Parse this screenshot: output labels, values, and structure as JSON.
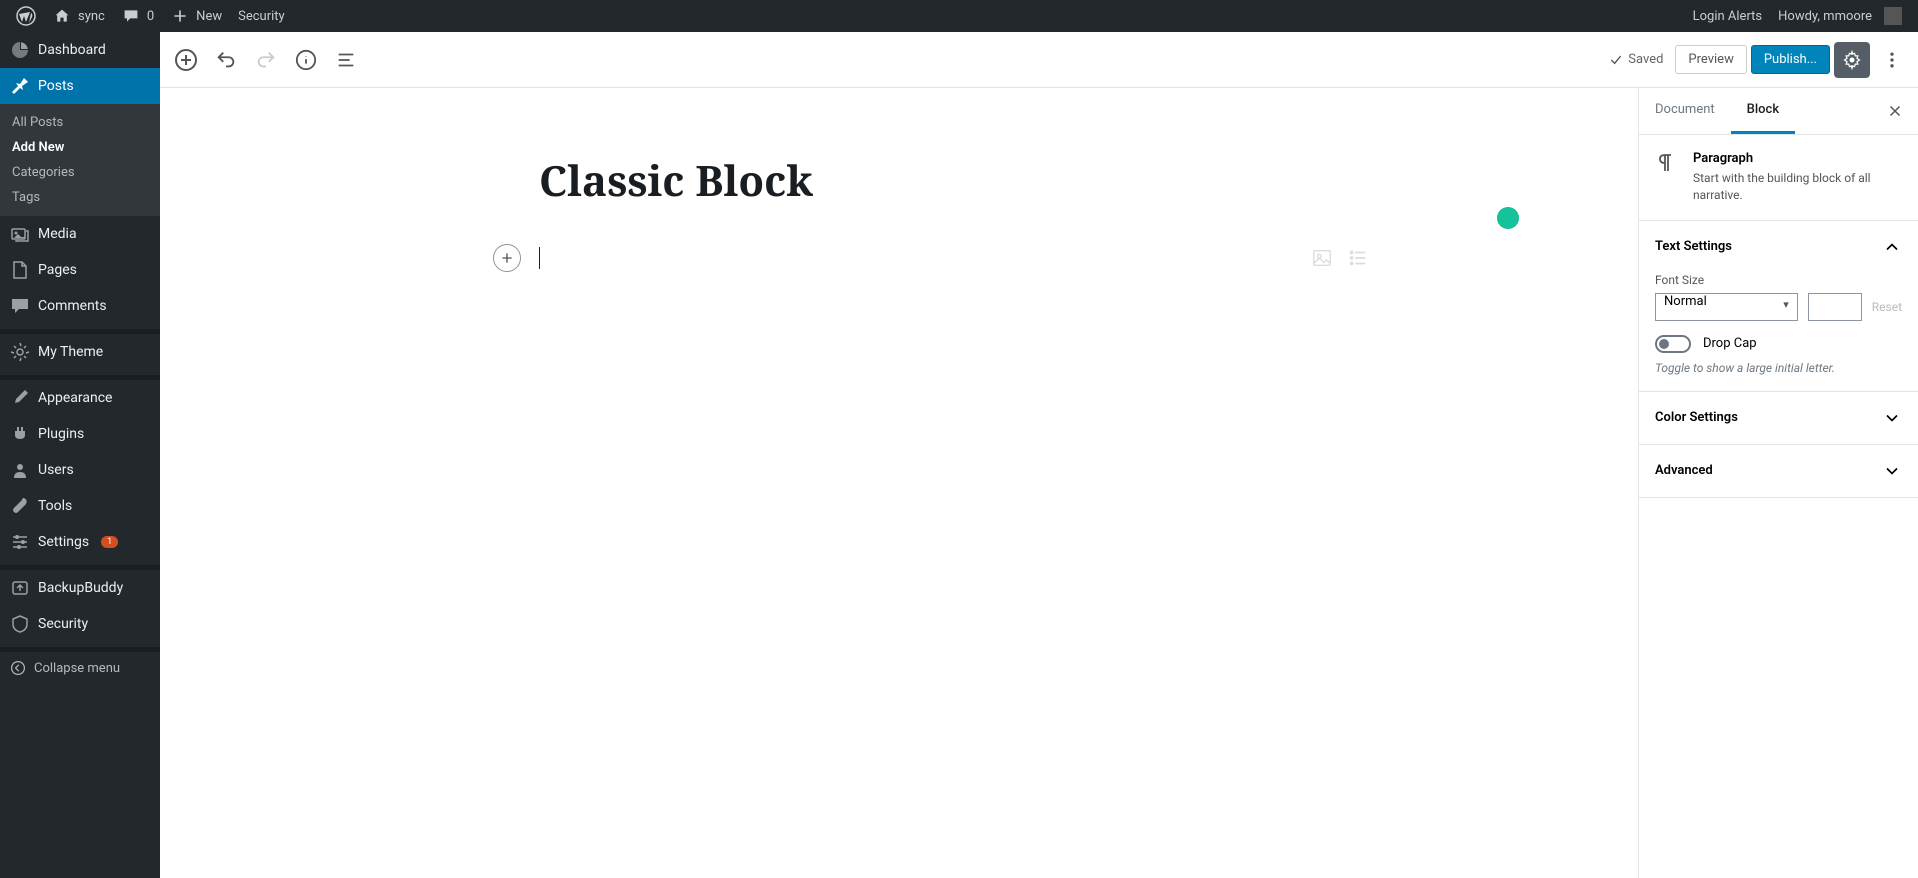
{
  "adminbar": {
    "site": "sync",
    "comment_count": "0",
    "new": "New",
    "security": "Security",
    "login_alerts": "Login Alerts",
    "howdy": "Howdy, mmoore"
  },
  "sidebar": {
    "items": [
      {
        "label": "Dashboard"
      },
      {
        "label": "Posts"
      },
      {
        "label": "Media"
      },
      {
        "label": "Pages"
      },
      {
        "label": "Comments"
      },
      {
        "label": "My Theme"
      },
      {
        "label": "Appearance"
      },
      {
        "label": "Plugins"
      },
      {
        "label": "Users"
      },
      {
        "label": "Tools"
      },
      {
        "label": "Settings",
        "badge": "1"
      },
      {
        "label": "BackupBuddy"
      },
      {
        "label": "Security"
      }
    ],
    "posts_sub": [
      {
        "label": "All Posts"
      },
      {
        "label": "Add New"
      },
      {
        "label": "Categories"
      },
      {
        "label": "Tags"
      }
    ],
    "collapse": "Collapse menu"
  },
  "editor": {
    "saved": "Saved",
    "preview": "Preview",
    "publish": "Publish...",
    "title": "Classic Block"
  },
  "settings": {
    "tabs": {
      "document": "Document",
      "block": "Block"
    },
    "block_name": "Paragraph",
    "block_desc": "Start with the building block of all narrative.",
    "panels": {
      "text": {
        "title": "Text Settings",
        "font_size_label": "Font Size",
        "font_size_value": "Normal",
        "reset": "Reset",
        "drop_cap": "Drop Cap",
        "drop_cap_desc": "Toggle to show a large initial letter."
      },
      "color": {
        "title": "Color Settings"
      },
      "advanced": {
        "title": "Advanced"
      }
    }
  }
}
